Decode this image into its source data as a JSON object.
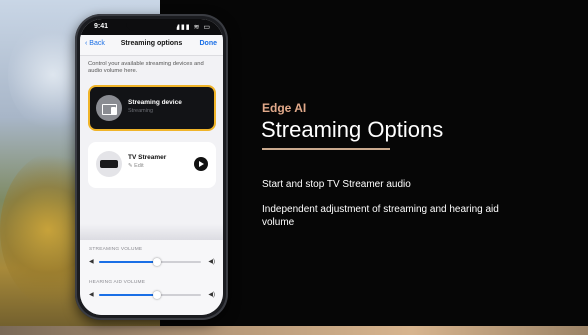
{
  "phone": {
    "status": {
      "time": "9:41",
      "icons": "▮▮▮ ≋ ▭"
    },
    "nav": {
      "back_label": "Back",
      "title": "Streaming options",
      "done_label": "Done"
    },
    "description": "Control your available streaming devices and audio volume here.",
    "devices": [
      {
        "name": "Streaming device",
        "status": "Streaming",
        "icon": "tv-remote-icon",
        "active": true
      },
      {
        "name": "TV Streamer",
        "status": "✎ Edit",
        "icon": "tv-box-icon",
        "active": false
      }
    ],
    "volume": {
      "streaming_label": "STREAMING VOLUME",
      "streaming_level": 0.57,
      "hearing_aid_label": "HEARING AID VOLUME",
      "hearing_aid_level": 0.57
    }
  },
  "slide": {
    "eyebrow": "Edge AI",
    "headline": "Streaming Options",
    "bullets": [
      "Start and stop TV Streamer audio",
      "Independent adjustment of streaming and hearing aid volume"
    ]
  },
  "colors": {
    "accent": "#f0b429",
    "eyebrow": "#e1a98a",
    "link": "#1a6fe6",
    "background": "#060606"
  }
}
